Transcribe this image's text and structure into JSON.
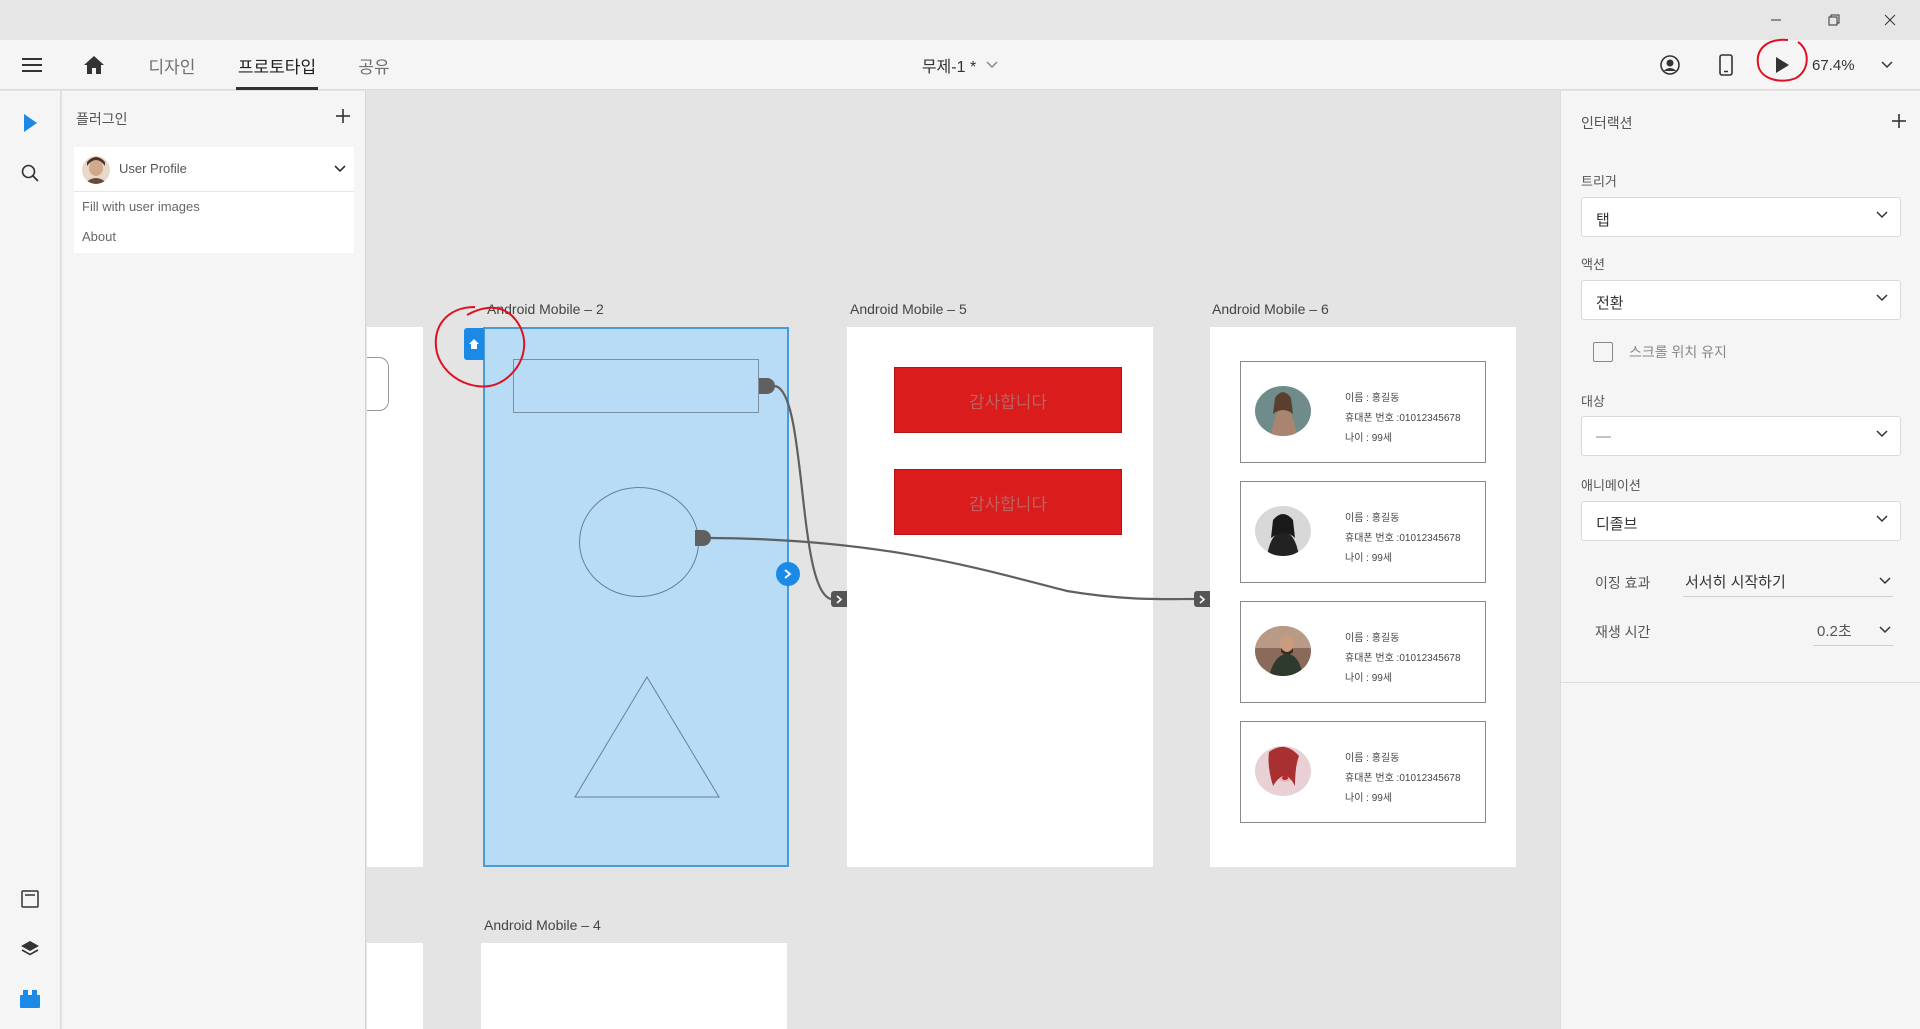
{
  "window": {
    "minimize": "—",
    "restore": "❐",
    "close": "✕"
  },
  "toolbar": {
    "tabs": [
      {
        "label": "디자인",
        "active": false
      },
      {
        "label": "프로토타입",
        "active": true
      },
      {
        "label": "공유",
        "active": false
      }
    ],
    "document_title": "무제-1 *",
    "zoom": "67.4%"
  },
  "plugins_panel": {
    "title": "플러그인",
    "plugin": {
      "name": "User Profile",
      "items": [
        "Fill with user images",
        "About"
      ]
    }
  },
  "canvas": {
    "artboards": [
      {
        "label": "Android Mobile – 2"
      },
      {
        "label": "Android Mobile – 5"
      },
      {
        "label": "Android Mobile – 6"
      },
      {
        "label": "Android Mobile – 4"
      }
    ],
    "thanks_label": "감사합니다",
    "profile_cards": [
      {
        "name": "이름 : 홍길동",
        "phone": "휴대폰 번호 :01012345678",
        "age": "나이 : 99세"
      },
      {
        "name": "이름 : 홍길동",
        "phone": "휴대폰 번호 :01012345678",
        "age": "나이 : 99세"
      },
      {
        "name": "이름 : 홍길동",
        "phone": "휴대폰 번호 :01012345678",
        "age": "나이 : 99세"
      },
      {
        "name": "이름 : 홍길동",
        "phone": "휴대폰 번호 :01012345678",
        "age": "나이 : 99세"
      }
    ]
  },
  "interaction_panel": {
    "title": "인터랙션",
    "trigger_label": "트리거",
    "trigger_value": "탭",
    "action_label": "액션",
    "action_value": "전환",
    "preserve_scroll_label": "스크롤 위치 유지",
    "destination_label": "대상",
    "destination_value": "—",
    "animation_label": "애니메이션",
    "animation_value": "디졸브",
    "easing_label": "이징 효과",
    "easing_value": "서서히 시작하기",
    "duration_label": "재생 시간",
    "duration_value": "0.2초"
  },
  "colors": {
    "accent": "#1a8ae6",
    "selection_fill": "#b8dcf6",
    "red_button": "#da1c1c",
    "annotation": "#e01020"
  }
}
